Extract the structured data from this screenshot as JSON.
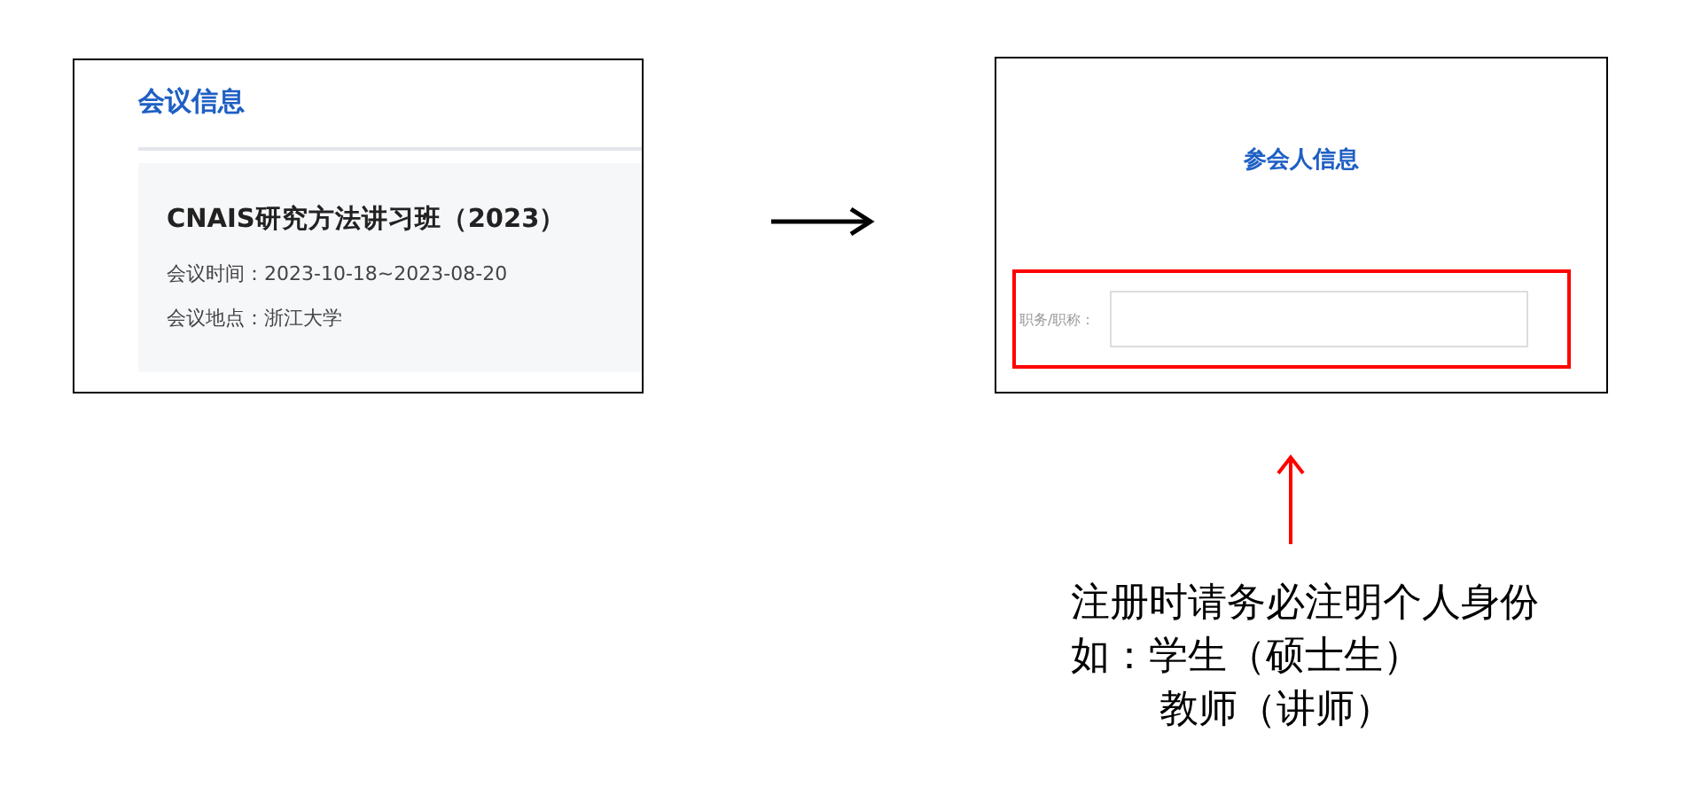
{
  "conference_panel": {
    "heading": "会议信息",
    "title": "CNAIS研究方法讲习班（2023）",
    "details": [
      "会议时间：2023-10-18~2023-08-20",
      "会议地点：浙江大学"
    ]
  },
  "attendee_panel": {
    "heading": "参会人信息",
    "field": {
      "label": "职务/职称："
    }
  },
  "note": {
    "lines": [
      "注册时请务必注明个人身份",
      "如：学生（硕士生）",
      "教师（讲师）"
    ]
  }
}
